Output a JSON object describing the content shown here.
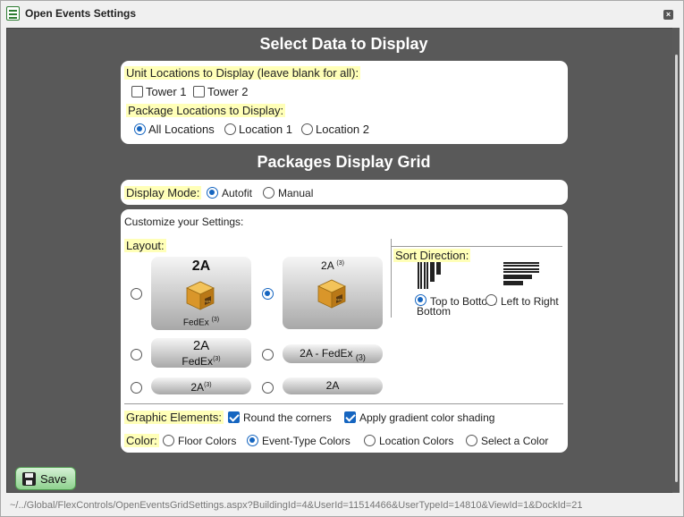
{
  "window": {
    "title": "Open Events Settings",
    "close_label": "×"
  },
  "section1_title": "Select Data to Display",
  "unit_locations": {
    "label": "Unit Locations to Display (leave blank for all):",
    "options": [
      {
        "label": "Tower 1",
        "checked": false
      },
      {
        "label": "Tower 2",
        "checked": false
      }
    ]
  },
  "package_locations": {
    "label": "Package Locations to Display:",
    "options": [
      {
        "label": "All Locations",
        "selected": true
      },
      {
        "label": "Location 1",
        "selected": false
      },
      {
        "label": "Location 2",
        "selected": false
      }
    ]
  },
  "section2_title": "Packages Display Grid",
  "display_mode": {
    "label": "Display Mode:",
    "options": [
      {
        "label": "Autofit",
        "selected": true
      },
      {
        "label": "Manual",
        "selected": false
      }
    ]
  },
  "customize": {
    "label": "Customize your Settings:",
    "layout_label": "Layout:",
    "layouts": {
      "big_fedex": {
        "unit": "2A",
        "carrier": "FedEx",
        "count": "(3)",
        "selected": false
      },
      "big_plain": {
        "unit": "2A",
        "count": "(3)",
        "selected": true
      },
      "mid_fedex": {
        "unit": "2A",
        "carrier": "FedEx",
        "count": "(3)",
        "selected": false
      },
      "line_fedex": {
        "text": "2A - FedEx",
        "count": "(3)",
        "selected": false
      },
      "small_count": {
        "unit": "2A",
        "count": "(3)",
        "selected": false
      },
      "small_plain": {
        "unit": "2A",
        "selected": false
      }
    },
    "sort_label": "Sort Direction:",
    "sort_options": [
      {
        "label": "Top to Bottom",
        "selected": true
      },
      {
        "label": "Left to Right",
        "selected": false
      }
    ],
    "graphic_label": "Graphic Elements:",
    "graphic_options": [
      {
        "label": "Round the corners",
        "checked": true
      },
      {
        "label": "Apply gradient color shading",
        "checked": true
      }
    ],
    "color_label": "Color:",
    "color_options": [
      {
        "label": "Floor Colors",
        "selected": false
      },
      {
        "label": "Event-Type Colors",
        "selected": true
      },
      {
        "label": "Location Colors",
        "selected": false
      },
      {
        "label": "Select a Color",
        "selected": false
      }
    ]
  },
  "save_label": "Save",
  "status_url": "~/../Global/FlexControls/OpenEventsGridSettings.aspx?BuildingId=4&UserId=11514466&UserTypeId=14810&ViewId=1&DockId=21",
  "colors": {
    "accent": "#1565c0",
    "highlight": "#ffffb8",
    "panel_bg": "#595959",
    "save_green": "#8fd28f"
  }
}
